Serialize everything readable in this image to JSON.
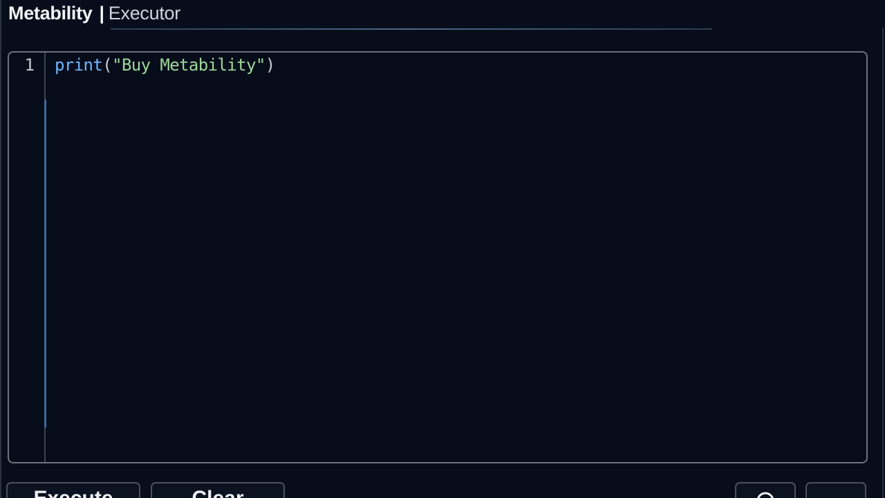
{
  "window": {
    "brand": "Metability",
    "separator": "|",
    "page": "Executor"
  },
  "editor": {
    "line_numbers": [
      "1"
    ],
    "code": {
      "fn": "print",
      "open_paren": "(",
      "string": "\"Buy Metability\"",
      "close_paren": ")"
    }
  },
  "toolbar": {
    "execute_label": "Execute",
    "clear_label": "Clear",
    "icon_button_1": "search-icon",
    "icon_button_2": "r6-icon"
  },
  "colors": {
    "background": "#070d1a",
    "function": "#6cb6ff",
    "string": "#9ed89a",
    "gutter_accent": "#3d6c9c"
  }
}
